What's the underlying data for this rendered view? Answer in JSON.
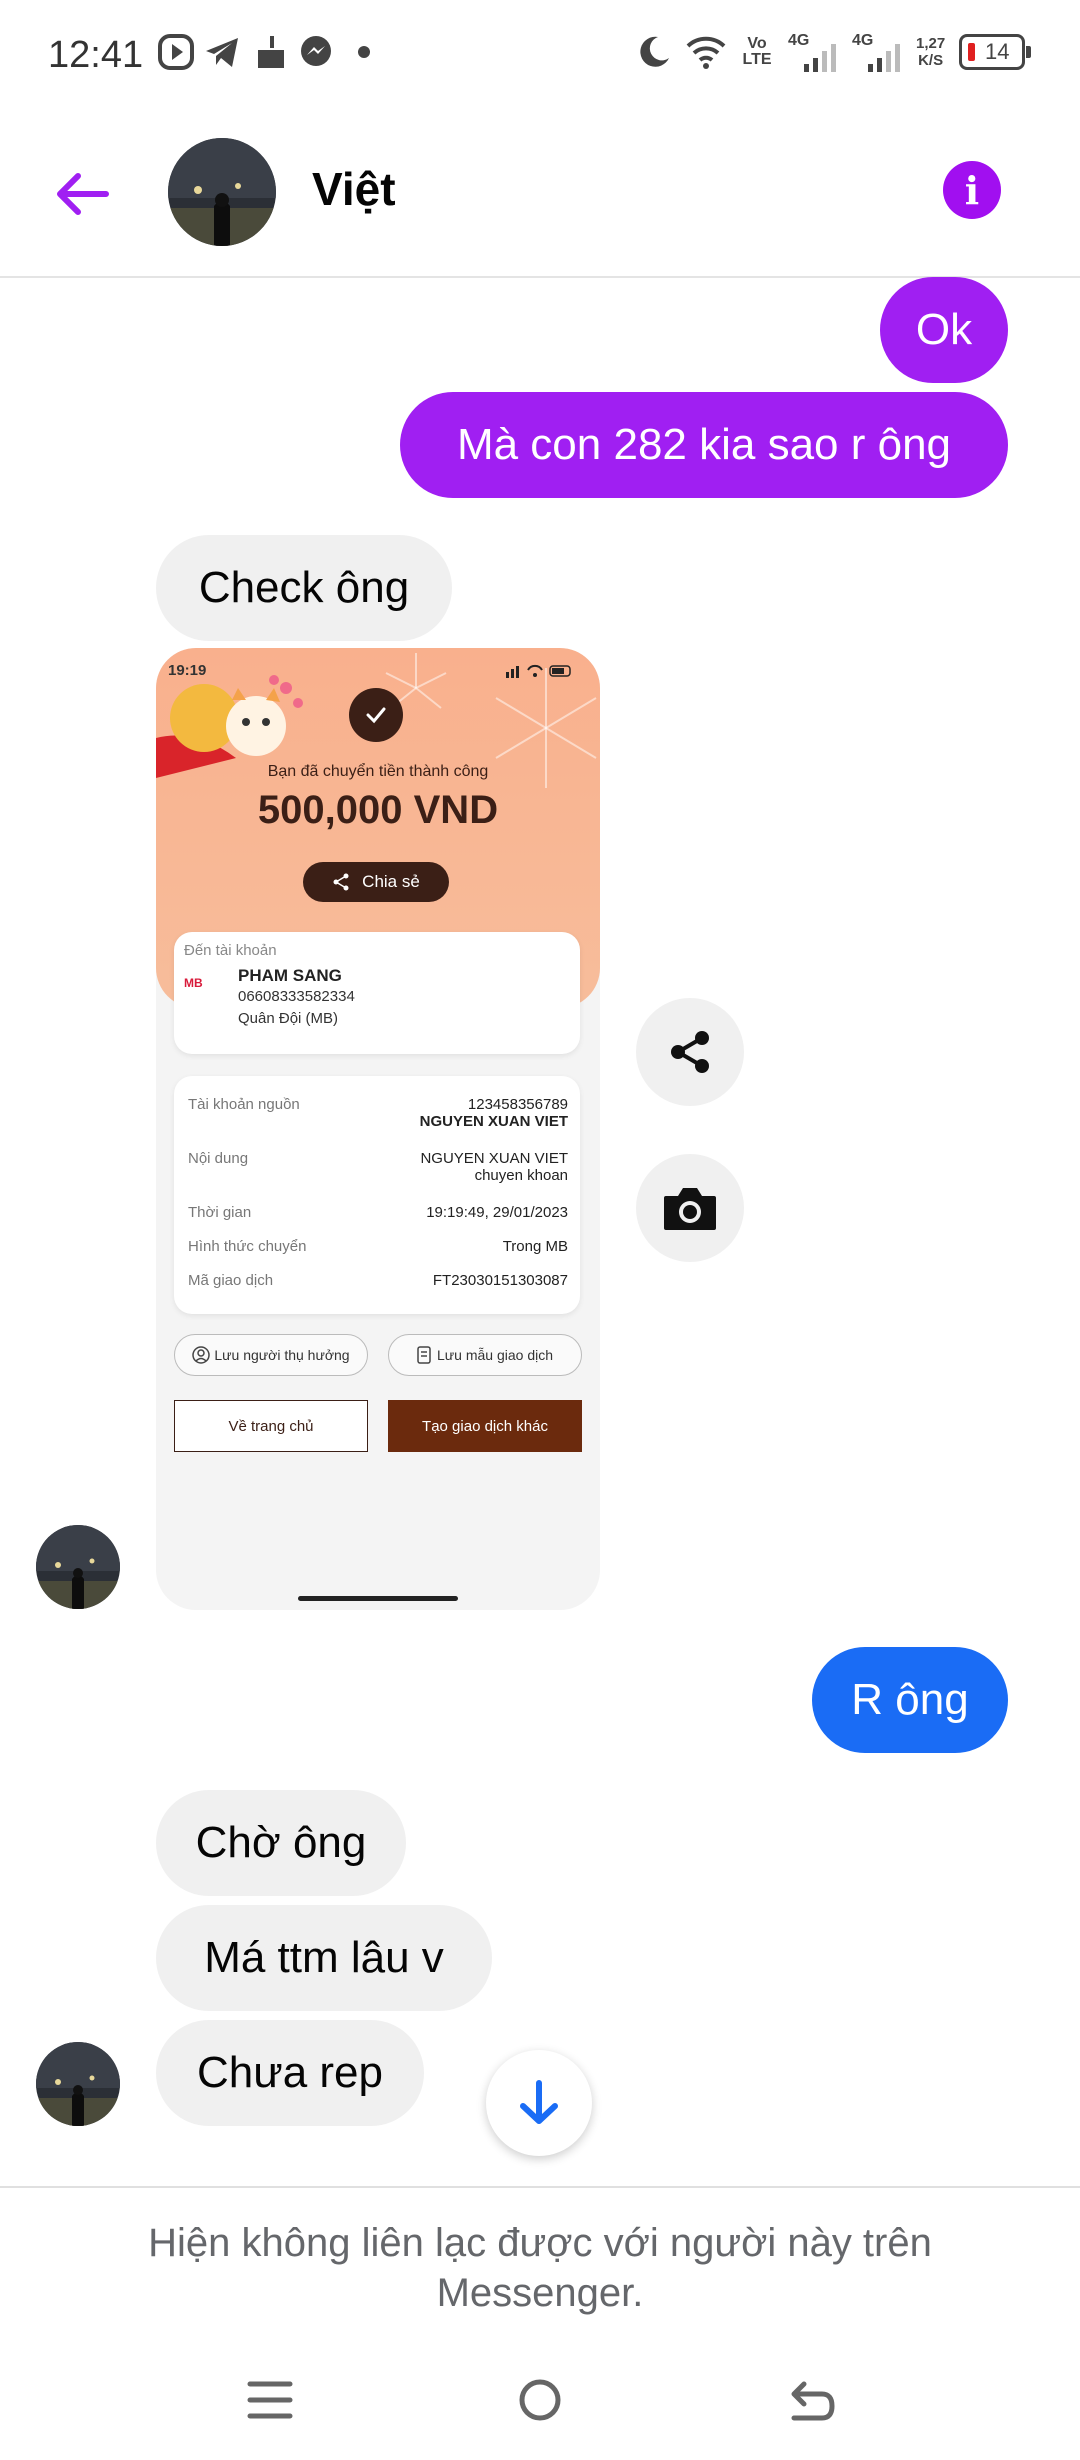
{
  "status_bar": {
    "time": "12:41",
    "network_1": "Vo LTE",
    "network_2": "4G",
    "network_3": "4G",
    "speed_value": "1,27",
    "speed_unit": "K/S",
    "battery": "14"
  },
  "header": {
    "contact_name": "Việt",
    "info_glyph": "i"
  },
  "messages": {
    "m1": "Ok",
    "m2": "Mà con 282 kia sao r ông",
    "m3": "Check ông",
    "m4": "R ông",
    "m5": "Chờ ông",
    "m6": "Má ttm lâu v",
    "m7": "Chưa rep"
  },
  "receipt": {
    "time": "19:19",
    "success_text": "Bạn đã chuyển tiền thành công",
    "amount": "500,000 VND",
    "share_label": "Chia sẻ",
    "to_account_label": "Đến tài khoản",
    "recipient_name": "PHAM SANG",
    "recipient_account": "06608333582334",
    "recipient_bank": "Quân Đội (MB)",
    "bank_logo": "MB",
    "rows": [
      {
        "label": "Tài khoản nguồn",
        "value1": "123458356789",
        "value2": "NGUYEN XUAN VIET"
      },
      {
        "label": "Nội dung",
        "value1": "NGUYEN XUAN VIET",
        "value2": "chuyen khoan"
      },
      {
        "label": "Thời gian",
        "value1": "19:19:49, 29/01/2023"
      },
      {
        "label": "Hình thức chuyển",
        "value1": "Trong MB"
      },
      {
        "label": "Mã giao dịch",
        "value1": "FT23030151303087"
      }
    ],
    "save_beneficiary": "Lưu người thụ hưởng",
    "save_template": "Lưu mẫu giao dịch",
    "home_button": "Về trang chủ",
    "new_transaction_button": "Tạo giao dịch khác"
  },
  "footer": {
    "notice": "Hiện không liên lạc được với người này trên Messenger."
  },
  "colors": {
    "accent": "#a01ff2",
    "blue_bubble": "#1a6cf5",
    "incoming_bubble": "#f0f0f0"
  },
  "icons": [
    "back-arrow-icon",
    "info-icon",
    "share-icon",
    "camera-icon",
    "arrow-down-icon",
    "menu-icon",
    "home-circle-icon",
    "back-nav-icon"
  ]
}
